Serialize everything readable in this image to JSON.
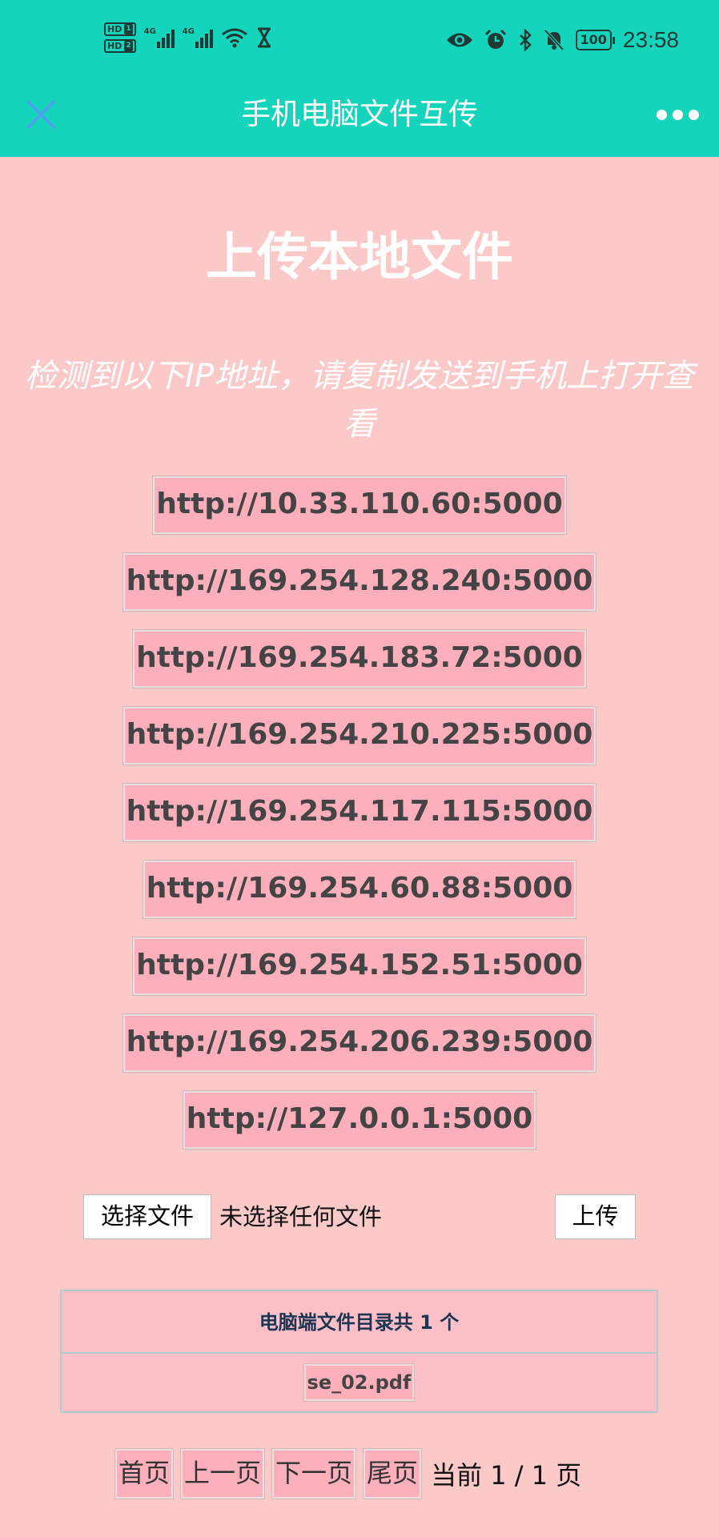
{
  "status_bar": {
    "sim1_label": "HD",
    "sim1_num": "1",
    "sim2_label": "HD",
    "sim2_num": "2",
    "net1": "4G",
    "net2": "4G",
    "time": "23:58",
    "battery": "100",
    "icons": [
      "eye-icon",
      "alarm-icon",
      "bluetooth-icon",
      "mute-bell-icon"
    ]
  },
  "nav": {
    "title": "手机电脑文件互传"
  },
  "main": {
    "heading": "上传本地文件",
    "description": "检测到以下IP地址，请复制发送到手机上打开查看",
    "ip_addresses": [
      "http://10.33.110.60:5000",
      "http://169.254.128.240:5000",
      "http://169.254.183.72:5000",
      "http://169.254.210.225:5000",
      "http://169.254.117.115:5000",
      "http://169.254.60.88:5000",
      "http://169.254.152.51:5000",
      "http://169.254.206.239:5000",
      "http://127.0.0.1:5000"
    ]
  },
  "upload": {
    "choose_label": "选择文件",
    "no_file_text": "未选择任何文件",
    "upload_label": "上传"
  },
  "file_table": {
    "header": "电脑端文件目录共 1 个",
    "files": [
      "se_02.pdf"
    ]
  },
  "pager": {
    "first": "首页",
    "prev": "上一页",
    "next": "下一页",
    "last": "尾页",
    "info": "当前 1 / 1 页"
  },
  "colors": {
    "header_bg": "#14d4bc",
    "page_bg": "#fcc9c9",
    "link_bg": "#fdb0bb",
    "close_icon": "#4aa3ea"
  }
}
